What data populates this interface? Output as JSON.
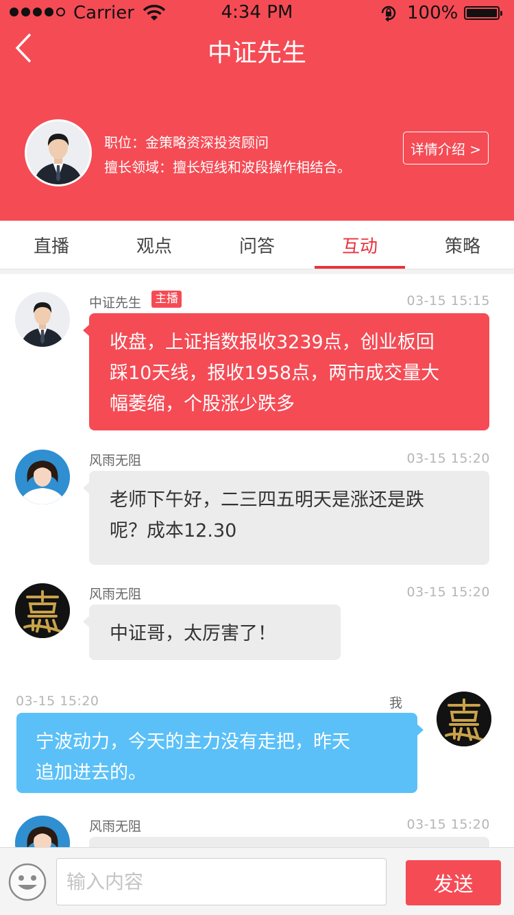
{
  "status_bar": {
    "carrier": "Carrier",
    "time": "4:34 PM",
    "battery": "100%"
  },
  "header": {
    "title": "中证先生",
    "position_line": "职位：金策略资深投资顾问",
    "specialty_line": "擅长领域：擅长短线和波段操作相结合。",
    "detail_button": "详情介绍 >"
  },
  "tabs": [
    {
      "label": "直播",
      "active": false
    },
    {
      "label": "观点",
      "active": false
    },
    {
      "label": "问答",
      "active": false
    },
    {
      "label": "互动",
      "active": true
    },
    {
      "label": "策略",
      "active": false
    }
  ],
  "messages": [
    {
      "sender": "中证先生",
      "badge": "主播",
      "time": "03-15  15:15",
      "lines": [
        "收盘，上证指数报收3239点，创业板回",
        "踩10天线，报收1958点，两市成交量大",
        "幅萎缩，个股涨少跌多"
      ]
    },
    {
      "sender": "风雨无阻",
      "time": "03-15  15:20",
      "lines": [
        "老师下午好，二三四五明天是涨还是跌",
        "呢？成本12.30"
      ]
    },
    {
      "sender": "风雨无阻",
      "time": "03-15  15:20",
      "lines": [
        "中证哥，太厉害了！"
      ]
    },
    {
      "sender": "我",
      "time": "03-15  15:20",
      "lines": [
        "宁波动力，今天的主力没有走把，昨天",
        "追加进去的。"
      ]
    },
    {
      "sender": "风雨无阻",
      "time": "03-15  15:20",
      "lines": []
    }
  ],
  "input_bar": {
    "placeholder": "输入内容",
    "send": "发送"
  },
  "colors": {
    "brand_red": "#f54b55",
    "tab_active": "#e8323c",
    "my_bubble": "#5bc0f8",
    "other_bubble": "#ececec"
  }
}
